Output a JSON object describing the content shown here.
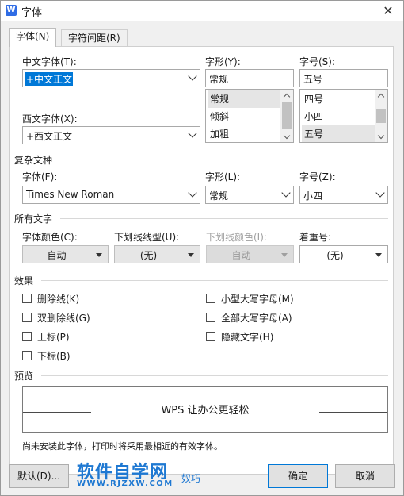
{
  "window": {
    "title": "字体",
    "app_icon_letter": "W"
  },
  "tabs": [
    {
      "label": "字体(N)",
      "active": true
    },
    {
      "label": "字符间距(R)",
      "active": false
    }
  ],
  "cjk_font": {
    "label": "中文字体(T):",
    "value": "+中文正文"
  },
  "latin_font": {
    "label": "西文字体(X):",
    "value": "+西文正文"
  },
  "style": {
    "label": "字形(Y):",
    "value": "常规",
    "options": [
      "常规",
      "倾斜",
      "加粗"
    ],
    "selected": "常规"
  },
  "size": {
    "label": "字号(S):",
    "value": "五号",
    "options": [
      "四号",
      "小四",
      "五号"
    ],
    "selected": "五号"
  },
  "complex": {
    "section": "复杂文种",
    "font_label": "字体(F):",
    "font_value": "Times New Roman",
    "style_label": "字形(L):",
    "style_value": "常规",
    "size_label": "字号(Z):",
    "size_value": "小四"
  },
  "all_text": {
    "section": "所有文字",
    "font_color_label": "字体颜色(C):",
    "font_color_value": "自动",
    "underline_type_label": "下划线线型(U):",
    "underline_type_value": "(无)",
    "underline_color_label": "下划线颜色(I):",
    "underline_color_value": "自动",
    "emphasis_label": "着重号:",
    "emphasis_value": "(无)"
  },
  "effects": {
    "section": "效果",
    "items": [
      {
        "label": "删除线(K)",
        "checked": false
      },
      {
        "label": "双删除线(G)",
        "checked": false
      },
      {
        "label": "上标(P)",
        "checked": false
      },
      {
        "label": "下标(B)",
        "checked": false
      },
      {
        "label": "小型大写字母(M)",
        "checked": false
      },
      {
        "label": "全部大写字母(A)",
        "checked": false
      },
      {
        "label": "隐藏文字(H)",
        "checked": false
      }
    ]
  },
  "preview": {
    "section": "预览",
    "text": "WPS 让办公更轻松"
  },
  "note": "尚未安装此字体，打印时将采用最相近的有效字体。",
  "buttons": {
    "default": "默认(D)...",
    "ok": "确定",
    "cancel": "取消"
  },
  "watermark": {
    "title": "软件自学网",
    "url": "WWW.RJZXW.COM",
    "fragment": "奴巧"
  },
  "colors": {
    "accent": "#0078d7",
    "watermark": "#1e78d2",
    "panel": "#ffffff",
    "dialog": "#f0f0f0"
  }
}
